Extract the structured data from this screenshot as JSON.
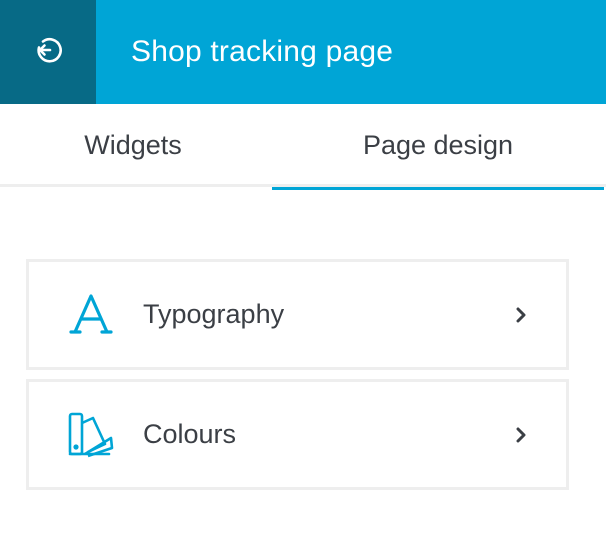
{
  "header": {
    "title": "Shop tracking page",
    "back_icon": "exit-arrow-icon"
  },
  "tabs": [
    {
      "label": "Widgets",
      "active": false
    },
    {
      "label": "Page design",
      "active": true
    }
  ],
  "cards": [
    {
      "label": "Typography",
      "icon": "typography-icon"
    },
    {
      "label": "Colours",
      "icon": "colour-palette-icon"
    }
  ],
  "colors": {
    "accent": "#00a5d6",
    "accent_dark": "#076a86",
    "text": "#3b3f45",
    "border": "#eeeeee"
  }
}
